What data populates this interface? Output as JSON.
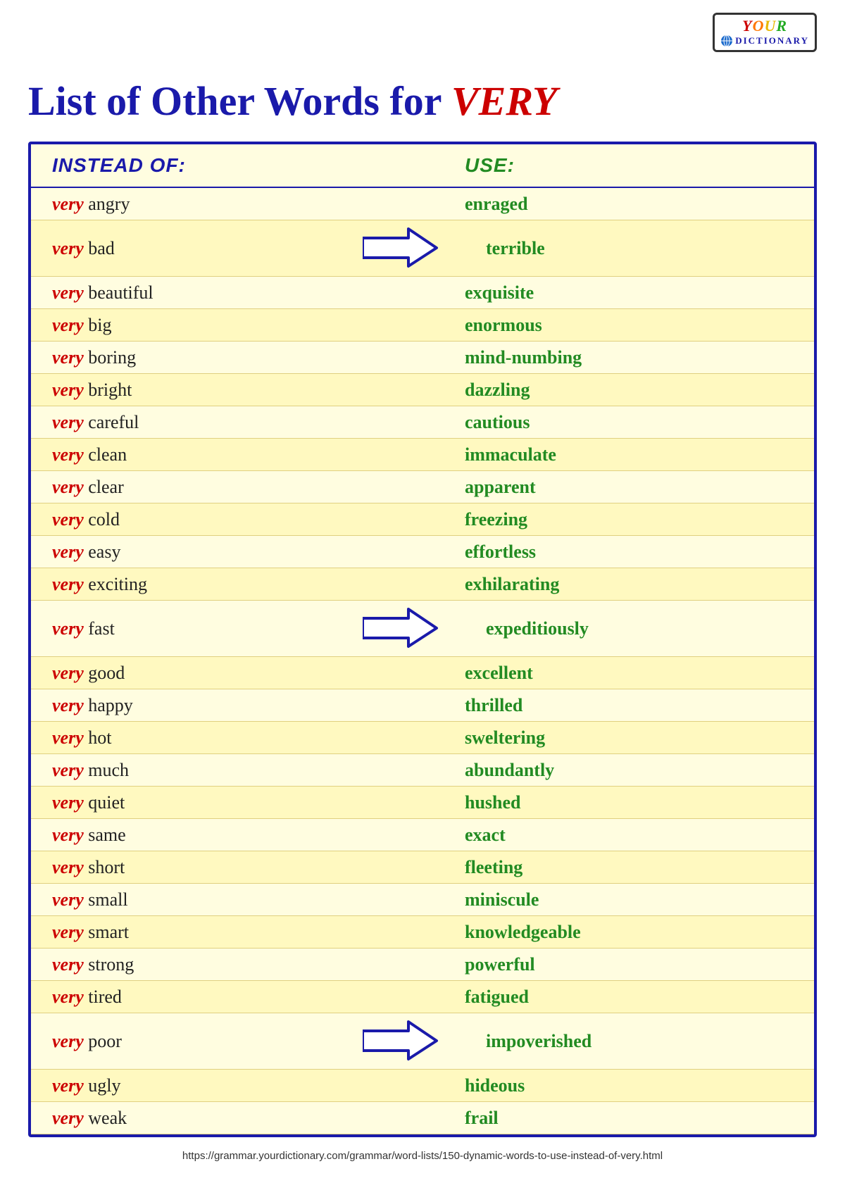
{
  "page": {
    "title": "List of Other Words for VERY",
    "title_prefix": "List of Other Words for ",
    "title_highlight": "VERY",
    "footer_url": "https://grammar.yourdictionary.com/grammar/word-lists/150-dynamic-words-to-use-instead-of-very.html"
  },
  "logo": {
    "your": "YOUR",
    "dictionary": "DICTIONARY"
  },
  "header": {
    "instead_of": "INSTEAD OF:",
    "use": "USE:"
  },
  "words": [
    {
      "phrase": "very angry",
      "replacement": "enraged",
      "arrow": false
    },
    {
      "phrase": "very bad",
      "replacement": "terrible",
      "arrow": true
    },
    {
      "phrase": "very beautiful",
      "replacement": "exquisite",
      "arrow": false
    },
    {
      "phrase": "very big",
      "replacement": "enormous",
      "arrow": false
    },
    {
      "phrase": "very boring",
      "replacement": "mind-numbing",
      "arrow": false
    },
    {
      "phrase": "very bright",
      "replacement": "dazzling",
      "arrow": false
    },
    {
      "phrase": "very careful",
      "replacement": "cautious",
      "arrow": false
    },
    {
      "phrase": "very clean",
      "replacement": "immaculate",
      "arrow": false
    },
    {
      "phrase": "very clear",
      "replacement": "apparent",
      "arrow": false
    },
    {
      "phrase": "very cold",
      "replacement": "freezing",
      "arrow": false
    },
    {
      "phrase": "very easy",
      "replacement": "effortless",
      "arrow": false
    },
    {
      "phrase": "very exciting",
      "replacement": "exhilarating",
      "arrow": false
    },
    {
      "phrase": "very fast",
      "replacement": "expeditiously",
      "arrow": true
    },
    {
      "phrase": "very good",
      "replacement": "excellent",
      "arrow": false
    },
    {
      "phrase": "very happy",
      "replacement": "thrilled",
      "arrow": false
    },
    {
      "phrase": "very hot",
      "replacement": "sweltering",
      "arrow": false
    },
    {
      "phrase": "very much",
      "replacement": "abundantly",
      "arrow": false
    },
    {
      "phrase": "very quiet",
      "replacement": "hushed",
      "arrow": false
    },
    {
      "phrase": "very same",
      "replacement": "exact",
      "arrow": false
    },
    {
      "phrase": "very short",
      "replacement": "fleeting",
      "arrow": false
    },
    {
      "phrase": "very small",
      "replacement": "miniscule",
      "arrow": false
    },
    {
      "phrase": "very smart",
      "replacement": "knowledgeable",
      "arrow": false
    },
    {
      "phrase": "very strong",
      "replacement": "powerful",
      "arrow": false
    },
    {
      "phrase": "very tired",
      "replacement": "fatigued",
      "arrow": false
    },
    {
      "phrase": "very poor",
      "replacement": "impoverished",
      "arrow": true
    },
    {
      "phrase": "very ugly",
      "replacement": "hideous",
      "arrow": false
    },
    {
      "phrase": "very weak",
      "replacement": "frail",
      "arrow": false
    }
  ],
  "colors": {
    "very_red": "#cc0000",
    "use_green": "#228B22",
    "header_blue": "#1a1aaa",
    "row_odd": "#fffde0",
    "row_even": "#fff9c0",
    "border": "#1a1aaa"
  }
}
